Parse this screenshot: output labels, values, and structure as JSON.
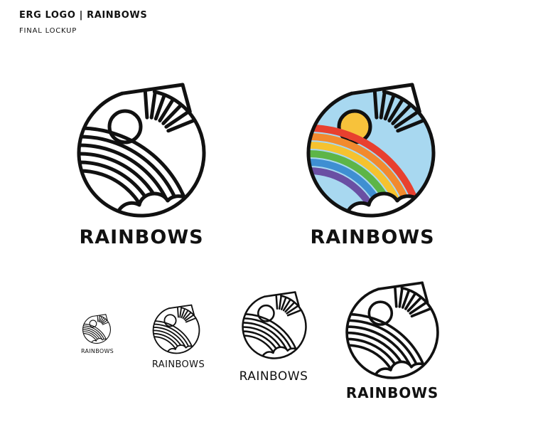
{
  "header": {
    "title": "ERG LOGO | RAINBOWS",
    "subtitle": "FINAL LOCKUP"
  },
  "wordmark": "RAINBOWS",
  "colors": {
    "stroke": "#111111",
    "sky": "#a8d8f0",
    "sun": "#f7c23b",
    "rainbow": [
      "#e8402f",
      "#f28a2e",
      "#f6c22f",
      "#5db548",
      "#3f8fd2",
      "#6a4fa3"
    ]
  }
}
